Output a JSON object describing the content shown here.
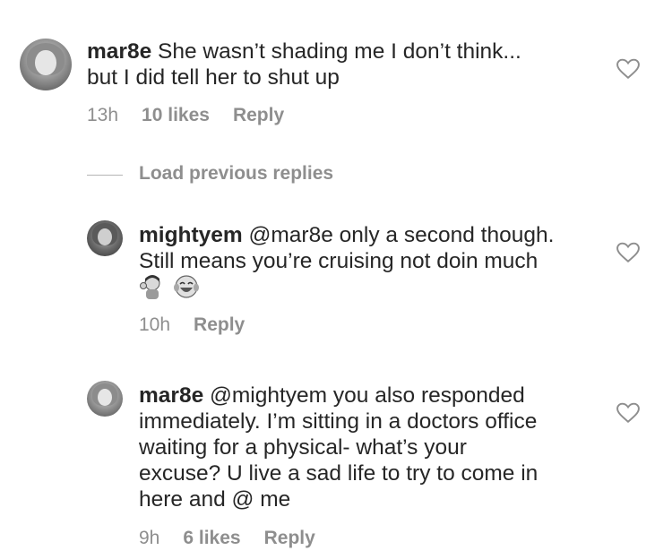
{
  "comments": [
    {
      "username": "mar8e",
      "text": "She wasn’t shading me I don’t think...",
      "text_line2": "but I did tell her to shut up",
      "time": "13h",
      "likes": "10 likes",
      "reply_label": "Reply"
    }
  ],
  "load_previous": "Load previous replies",
  "replies": [
    {
      "username": "mightyem",
      "line1": "@mar8e only a second though.",
      "line2": "Still means you’re cruising not doin much",
      "emoji_names": [
        "woman-tipping-hand-emoji",
        "tears-of-joy-emoji"
      ],
      "time": "10h",
      "reply_label": "Reply"
    },
    {
      "username": "mar8e",
      "line1": "@mightyem you also responded",
      "line2": "immediately. I’m sitting in a doctors office",
      "line3": "waiting for a physical- what’s your",
      "line4": "excuse? U live a sad life to try to come in",
      "line5": "here and @ me",
      "time": "9h",
      "likes": "6 likes",
      "reply_label": "Reply"
    }
  ]
}
